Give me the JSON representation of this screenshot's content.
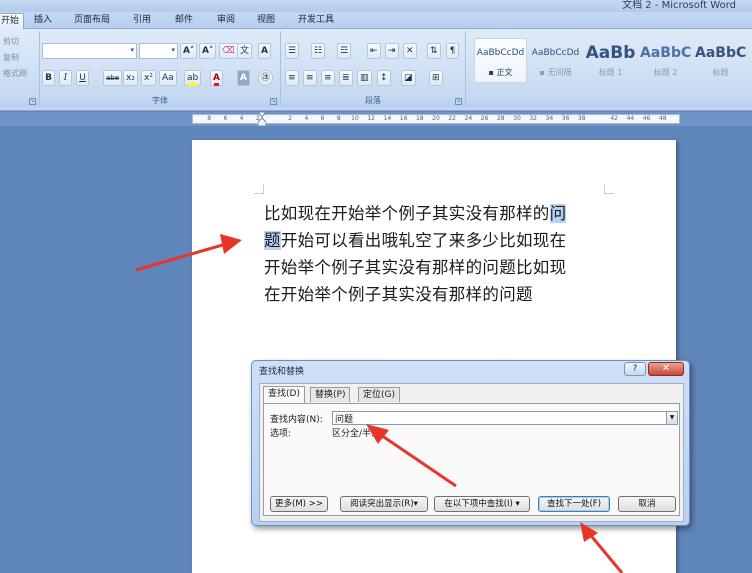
{
  "window": {
    "title": "文档 2 - Microsoft Word"
  },
  "tabs": [
    {
      "label": "开始",
      "active": true
    },
    {
      "label": "插入"
    },
    {
      "label": "页面布局"
    },
    {
      "label": "引用"
    },
    {
      "label": "邮件"
    },
    {
      "label": "审阅"
    },
    {
      "label": "视图"
    },
    {
      "label": "开发工具"
    }
  ],
  "ribbon": {
    "clipboard": {
      "items": [
        "剪切",
        "复制",
        "格式刷"
      ]
    },
    "font_group_label": "字体",
    "paragraph_group_label": "段落",
    "font_buttons": [
      "B",
      "I",
      "U",
      "abe",
      "x₂",
      "x²",
      "Aa",
      "A",
      "A",
      "A"
    ],
    "grow_font": "A˄",
    "shrink_font": "A˅",
    "styles": [
      {
        "sample": "AaBbCcDd",
        "name": "正文",
        "selected": true
      },
      {
        "sample": "AaBbCcDd",
        "name": "无间隔"
      },
      {
        "sample": "AaBb",
        "name": "标题 1"
      },
      {
        "sample": "AaBbC",
        "name": "标题 2"
      },
      {
        "sample": "AaBbC",
        "name": "标题"
      }
    ]
  },
  "ruler": {
    "ticks": [
      "8",
      "6",
      "4",
      "2",
      "",
      "2",
      "4",
      "6",
      "8",
      "10",
      "12",
      "14",
      "16",
      "18",
      "20",
      "22",
      "24",
      "26",
      "28",
      "30",
      "32",
      "34",
      "36",
      "38",
      "",
      "42",
      "44",
      "46",
      "48"
    ]
  },
  "document": {
    "lines": [
      [
        "比如现在开始举个例子其实没有那样的",
        "问"
      ],
      [
        "题",
        "开始可以看出哦轧空了来多少比如现在"
      ],
      [
        "开始举个例子其实没有那样的问题比如现"
      ],
      [
        "在开始举个例子其实没有那样的问题"
      ]
    ]
  },
  "dialog": {
    "title": "查找和替换",
    "help": "?",
    "close": "✕",
    "tabs": [
      "查找(D)",
      "替换(P)",
      "定位(G)"
    ],
    "find_label": "查找内容(N):",
    "find_value": "问题",
    "options_label": "选项:",
    "options_value": "区分全/半角",
    "buttons": {
      "more": "更多(M) >>",
      "reading_highlight": "阅读突出显示(R)▾",
      "find_in": "在以下项中查找(I) ▾",
      "find_next": "查找下一处(F)",
      "cancel": "取消"
    }
  },
  "colors": {
    "annotation_arrow": "#e8352a",
    "selection": "#b9d1f3"
  }
}
